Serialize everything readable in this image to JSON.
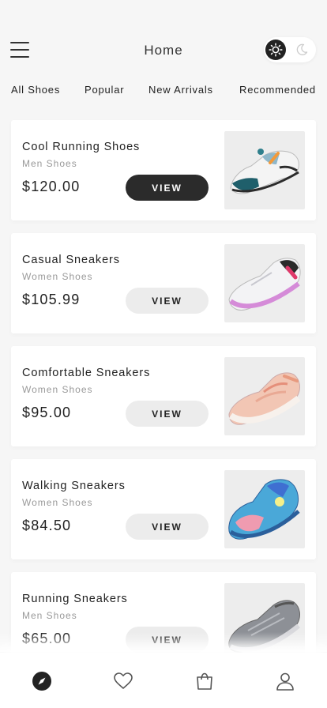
{
  "header": {
    "title": "Home",
    "menu_icon": "hamburger-menu-icon",
    "theme_toggle": {
      "active": "light",
      "light_icon": "sun-icon",
      "dark_icon": "moon-icon"
    }
  },
  "tabs": [
    {
      "label": "All Shoes"
    },
    {
      "label": "Popular"
    },
    {
      "label": "New Arrivals"
    },
    {
      "label": "Recommended"
    }
  ],
  "products": [
    {
      "name": "Cool Running Shoes",
      "category": "Men Shoes",
      "price": "$120.00",
      "button": "VIEW",
      "active": true
    },
    {
      "name": "Casual Sneakers",
      "category": "Women Shoes",
      "price": "$105.99",
      "button": "VIEW",
      "active": false
    },
    {
      "name": "Comfortable Sneakers",
      "category": "Women Shoes",
      "price": "$95.00",
      "button": "VIEW",
      "active": false
    },
    {
      "name": "Walking Sneakers",
      "category": "Women Shoes",
      "price": "$84.50",
      "button": "VIEW",
      "active": false
    },
    {
      "name": "Running Sneakers",
      "category": "Men Shoes",
      "price": "$65.00",
      "button": "VIEW",
      "active": false
    }
  ],
  "bottom_nav": [
    {
      "icon": "compass-icon",
      "active": true
    },
    {
      "icon": "heart-icon",
      "active": false
    },
    {
      "icon": "shopping-bag-icon",
      "active": false
    },
    {
      "icon": "user-icon",
      "active": false
    }
  ],
  "colors": {
    "background": "#f6f6f6",
    "card": "#ffffff",
    "accent_dark": "#2b2b2b",
    "button_light": "#ececec",
    "muted_text": "#999999"
  }
}
